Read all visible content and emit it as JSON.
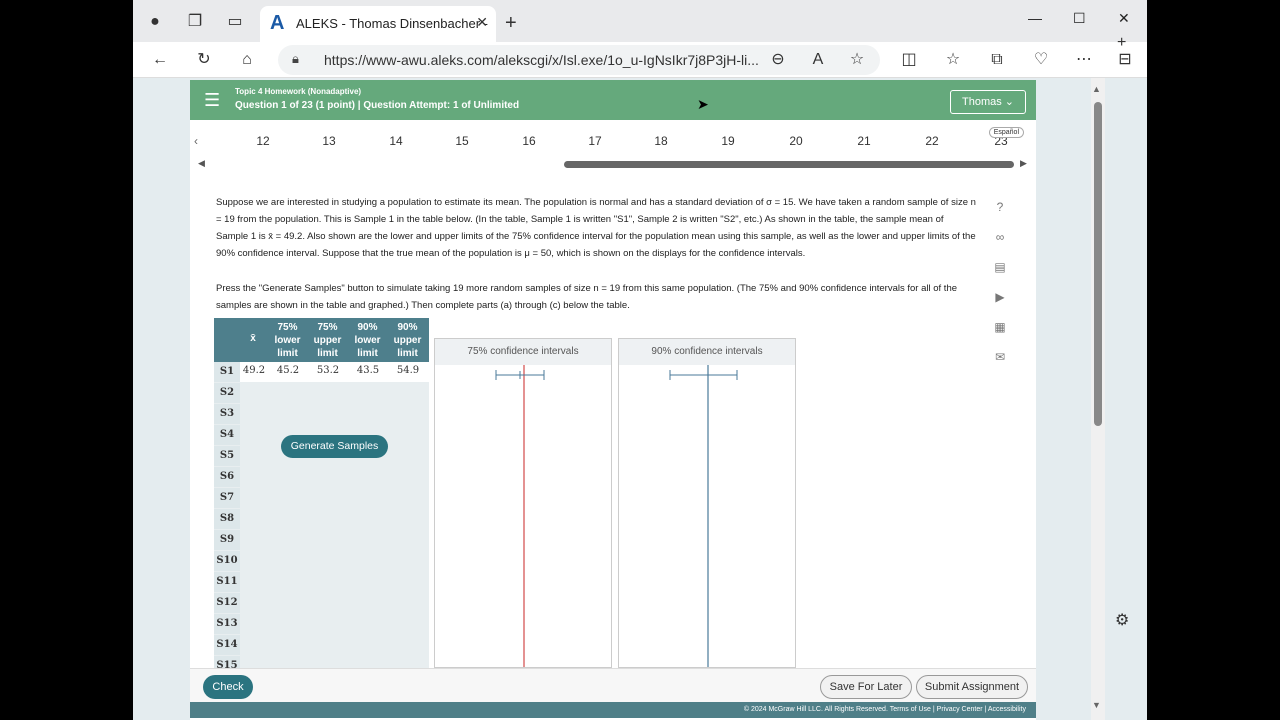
{
  "browser": {
    "tab_title": "ALEKS - Thomas Dinsenbacher -",
    "tab_logo": "A",
    "url": "https://www-awu.aleks.com/alekscgi/x/Isl.exe/1o_u-IgNsIkr7j8P3jH-li..."
  },
  "header": {
    "topic": "Topic 4 Homework (Nonadaptive)",
    "question_info": "Question 1 of 23 (1 point)  |  Question Attempt: 1 of Unlimited",
    "user": "Thomas"
  },
  "qnav": {
    "numbers": [
      "12",
      "13",
      "14",
      "15",
      "16",
      "17",
      "18",
      "19",
      "20",
      "21",
      "22",
      "23"
    ],
    "espanol": "Español"
  },
  "problem": {
    "p1": "Suppose we are interested in studying a population to estimate its mean. The population is normal and has a standard deviation of σ = 15. We have taken a random sample of size n = 19 from the population. This is Sample 1 in the table below. (In the table, Sample 1 is written \"S1\", Sample 2 is written \"S2\", etc.) As shown in the table, the sample mean of Sample 1 is x̄ = 49.2. Also shown are the lower and upper limits of the 75% confidence interval for the population mean using this sample, as well as the lower and upper limits of the 90% confidence interval. Suppose that the true mean of the population is μ = 50, which is shown on the displays for the confidence intervals.",
    "p2": "Press the \"Generate Samples\" button to simulate taking 19 more random samples of size n = 19 from this same population. (The 75% and 90% confidence intervals for all of the samples are shown in the table and graphed.) Then complete parts (a) through (c) below the table."
  },
  "table": {
    "headers": [
      "x̄",
      "75% lower limit",
      "75% upper limit",
      "90% lower limit",
      "90% upper limit"
    ],
    "s1": [
      "49.2",
      "45.2",
      "53.2",
      "43.5",
      "54.9"
    ],
    "rows": [
      "S1",
      "S2",
      "S3",
      "S4",
      "S5",
      "S6",
      "S7",
      "S8",
      "S9",
      "S10",
      "S11",
      "S12",
      "S13",
      "S14",
      "S15"
    ]
  },
  "generate_button": "Generate Samples",
  "panels": {
    "p75": "75% confidence intervals",
    "p90": "90% confidence intervals"
  },
  "footer": {
    "check": "Check",
    "save": "Save For Later",
    "submit": "Submit Assignment",
    "copyright": "© 2024 McGraw Hill LLC. All Rights Reserved.   Terms of Use  |  Privacy Center  |  Accessibility"
  },
  "colors": {
    "header_green": "#65a97c",
    "teal": "#2b7480",
    "mean_line_75": "#d14a4a",
    "mean_line_90": "#4a7a9a"
  }
}
